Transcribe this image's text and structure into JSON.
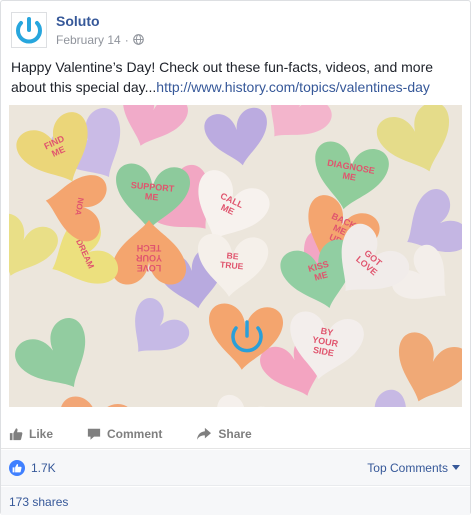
{
  "post": {
    "page_name": "Soluto",
    "date": "February 14",
    "separator": "·",
    "text": "Happy Valentine’s Day! Check out these fun-facts, videos, and more about this special day...",
    "link": "http://www.history.com/topics/valentines-day"
  },
  "photo": {
    "hearts": [
      {
        "text": "FIND ME",
        "color": "#ebd679"
      },
      {
        "text": "SUPPORT ME",
        "color": "#8dca9c"
      },
      {
        "text": "CALL ME",
        "color": "#f7f2ee"
      },
      {
        "text": "DIAGNOSE ME",
        "color": "#90cd9b"
      },
      {
        "text": "BACK ME UP",
        "color": "#f4a56f"
      },
      {
        "text": "BE TRUE",
        "color": "#f5f0ea"
      },
      {
        "text": "KISS ME",
        "color": "#91cea2"
      },
      {
        "text": "GOT LOVE",
        "color": "#f1ecea"
      },
      {
        "text": "LOVE YOUR TECH",
        "color": "#f4a56e"
      },
      {
        "text": "BY YOUR SIDE",
        "color": "#f3eeec"
      },
      {
        "text": "DREAM",
        "color": "#ece07e"
      },
      {
        "text": "NOA",
        "color": "#f4a56f"
      }
    ]
  },
  "actions": {
    "like": "Like",
    "comment": "Comment",
    "share": "Share"
  },
  "stats": {
    "likes": "1.7K",
    "top_comments": "Top Comments",
    "shares": "173 shares"
  },
  "colors": {
    "brand_blue": "#365899",
    "soluto_logo": "#27a6dd",
    "like_blue": "#4080ff"
  }
}
